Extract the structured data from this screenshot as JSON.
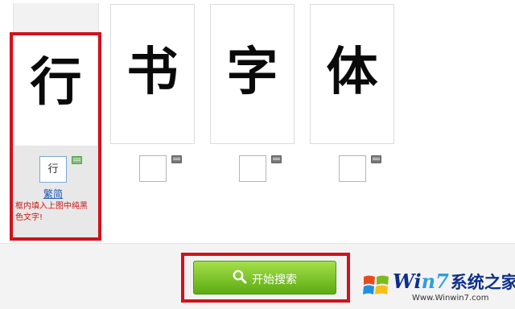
{
  "cards": [
    {
      "glyph": "行",
      "input_value": "行"
    },
    {
      "glyph": "书",
      "input_value": ""
    },
    {
      "glyph": "字",
      "input_value": ""
    },
    {
      "glyph": "体",
      "input_value": ""
    }
  ],
  "first_column": {
    "toggle_label": "繁简",
    "hint_text": "框内填入上图中纯黑色文字!"
  },
  "search_button": {
    "label": "开始搜索",
    "icon": "search-icon"
  },
  "watermark": {
    "brand_prefix": "Wi",
    "brand_accent": "n7",
    "brand_cn": "系统之家",
    "url": "Www.Winwin7.com"
  },
  "colors": {
    "highlight": "#d1121b",
    "button": "#6fbf1c",
    "hint": "#cc1414",
    "link": "#1a58b5"
  }
}
